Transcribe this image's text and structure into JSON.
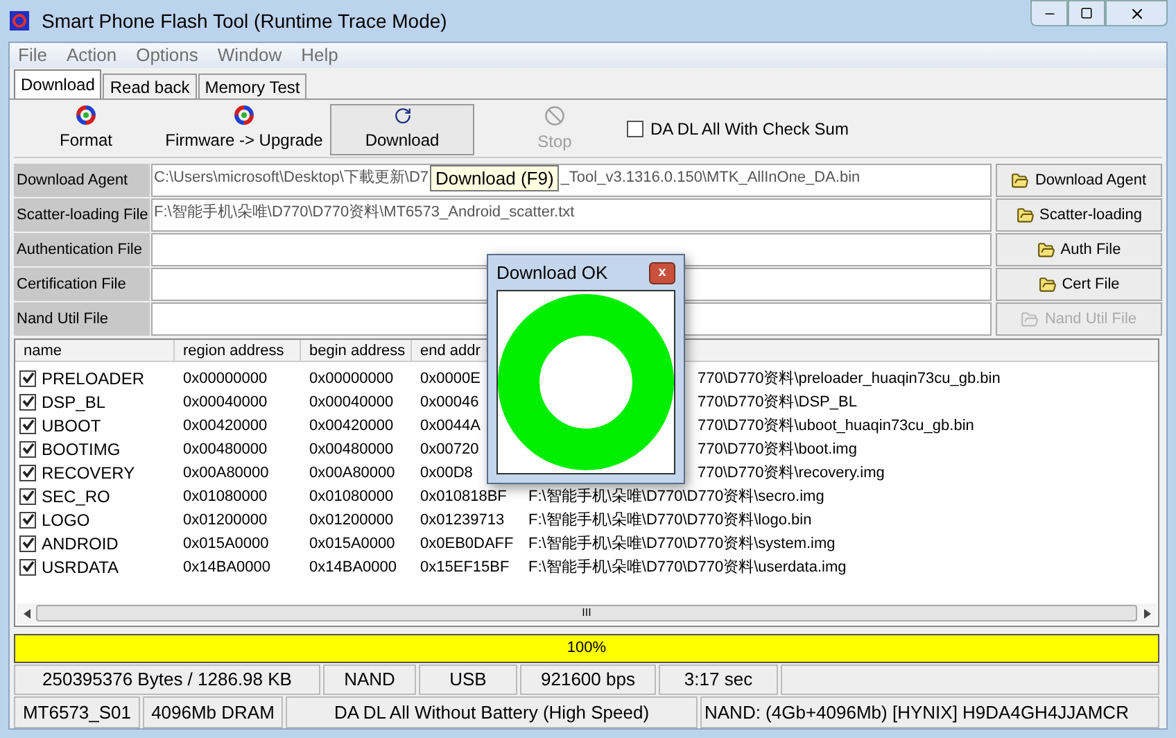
{
  "window": {
    "title": "Smart Phone Flash Tool (Runtime Trace Mode)"
  },
  "menu": [
    "File",
    "Action",
    "Options",
    "Window",
    "Help"
  ],
  "tabs": [
    {
      "label": "Download",
      "selected": true
    },
    {
      "label": "Read back",
      "selected": false
    },
    {
      "label": "Memory Test",
      "selected": false
    }
  ],
  "toolbar": [
    {
      "label": "Format",
      "kind": "colorful",
      "disabled": false,
      "pressed": false
    },
    {
      "label": "Firmware -> Upgrade",
      "kind": "colorful",
      "disabled": false,
      "pressed": false
    },
    {
      "label": "Download",
      "kind": "arrow",
      "disabled": false,
      "pressed": true
    },
    {
      "label": "Stop",
      "kind": "stop",
      "disabled": true,
      "pressed": false
    }
  ],
  "checksum": {
    "label": "DA DL All With Check Sum",
    "checked": false
  },
  "tooltip": "Download (F9)",
  "files": [
    {
      "label": "Download Agent",
      "value": [
        "C:\\Users\\microsoft\\Desktop\\下載更新\\D7",
        "_Tool_v3.1316.0.150\\MTK_AllInOne_DA.bin"
      ],
      "button": "Download Agent",
      "disabled": false
    },
    {
      "label": "Scatter-loading File",
      "value": [
        "F:\\智能手机\\朵唯\\D770\\D770资料\\MT6573_Android_scatter.txt"
      ],
      "button": "Scatter-loading",
      "disabled": false
    },
    {
      "label": "Authentication File",
      "button": "Auth File",
      "disabled": false
    },
    {
      "label": "Certification File",
      "button": "Cert File",
      "disabled": false
    },
    {
      "label": "Nand Util File",
      "button": "Nand Util File",
      "disabled": true
    }
  ],
  "table": {
    "columns": [
      "name",
      "region address",
      "begin address",
      "end addr"
    ],
    "rows": [
      {
        "checked": true,
        "name": "PRELOADER",
        "region": "0x00000000",
        "begin": "0x00000000",
        "end": "0x0000E",
        "path": "770\\D770资料\\preloader_huaqin73cu_gb.bin"
      },
      {
        "checked": true,
        "name": "DSP_BL",
        "region": "0x00040000",
        "begin": "0x00040000",
        "end": "0x00046",
        "path": "770\\D770资料\\DSP_BL"
      },
      {
        "checked": true,
        "name": "UBOOT",
        "region": "0x00420000",
        "begin": "0x00420000",
        "end": "0x0044A",
        "path": "770\\D770资料\\uboot_huaqin73cu_gb.bin"
      },
      {
        "checked": true,
        "name": "BOOTIMG",
        "region": "0x00480000",
        "begin": "0x00480000",
        "end": "0x00720",
        "path": "770\\D770资料\\boot.img"
      },
      {
        "checked": true,
        "name": "RECOVERY",
        "region": "0x00A80000",
        "begin": "0x00A80000",
        "end": "0x00D8",
        "path": "770\\D770资料\\recovery.img"
      },
      {
        "checked": true,
        "name": "SEC_RO",
        "region": "0x01080000",
        "begin": "0x01080000",
        "end": "0x010818BF",
        "path": "F:\\智能手机\\朵唯\\D770\\D770资料\\secro.img"
      },
      {
        "checked": true,
        "name": "LOGO",
        "region": "0x01200000",
        "begin": "0x01200000",
        "end": "0x01239713",
        "path": "F:\\智能手机\\朵唯\\D770\\D770资料\\logo.bin"
      },
      {
        "checked": true,
        "name": "ANDROID",
        "region": "0x015A0000",
        "begin": "0x015A0000",
        "end": "0x0EB0DAFF",
        "path": "F:\\智能手机\\朵唯\\D770\\D770资料\\system.img"
      },
      {
        "checked": true,
        "name": "USRDATA",
        "region": "0x14BA0000",
        "begin": "0x14BA0000",
        "end": "0x15EF15BF",
        "path": "F:\\智能手机\\朵唯\\D770\\D770资料\\userdata.img"
      }
    ]
  },
  "scroll_grip": "III",
  "progress": {
    "level": 1,
    "label": "100%"
  },
  "status": [
    [
      "250395376 Bytes / 1286.98 KB",
      "NAND",
      "USB",
      "921600 bps",
      "3:17 sec"
    ],
    [
      "MT6573_S01",
      "4096Mb DRAM",
      "DA DL All Without Battery (High Speed)",
      "NAND: (4Gb+4096Mb) [HYNIX] H9DA4GH4JJAMCR"
    ]
  ],
  "dialog": {
    "title": "Download OK",
    "close": "x"
  }
}
